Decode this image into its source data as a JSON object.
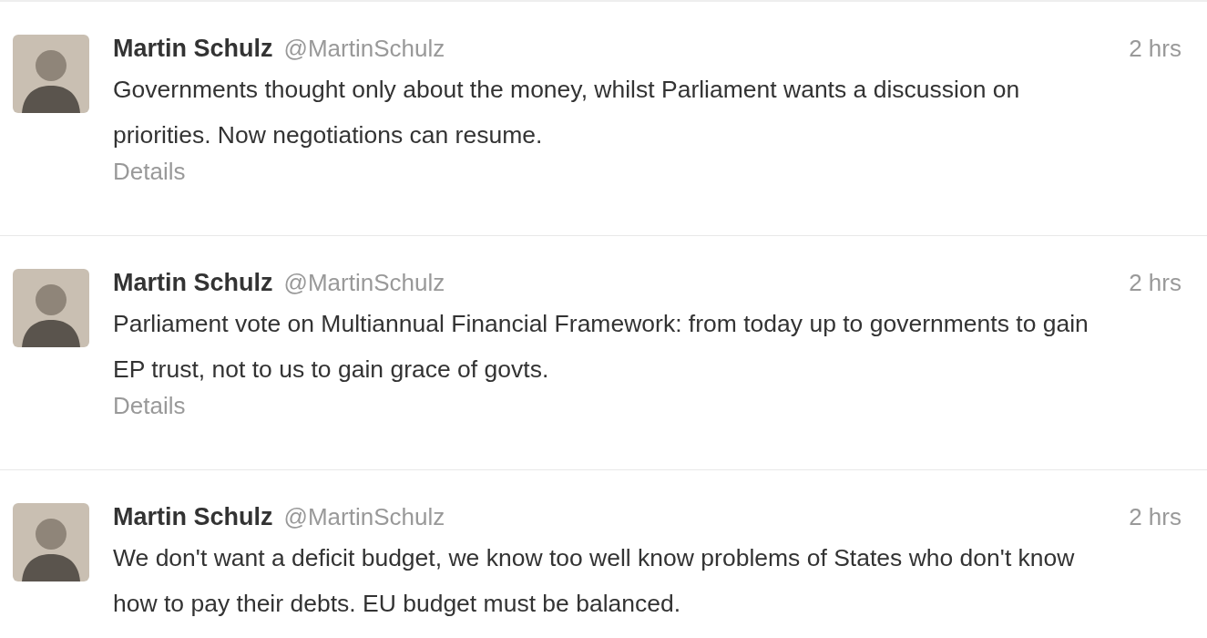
{
  "tweets": [
    {
      "name": "Martin Schulz",
      "handle": "@MartinSchulz",
      "time": "2 hrs",
      "text": "Governments thought only about the money, whilst Parliament wants a discussion on priorities. Now negotiations can resume.",
      "details": "Details"
    },
    {
      "name": "Martin Schulz",
      "handle": "@MartinSchulz",
      "time": "2 hrs",
      "text": "Parliament vote on Multiannual Financial Framework: from today up to governments to gain EP trust, not to us to gain grace of govts.",
      "details": "Details"
    },
    {
      "name": "Martin Schulz",
      "handle": "@MartinSchulz",
      "time": "2 hrs",
      "text": "We don't want a deficit budget, we know too well know problems of States who don't know how to pay their debts. EU budget must be balanced."
    }
  ]
}
